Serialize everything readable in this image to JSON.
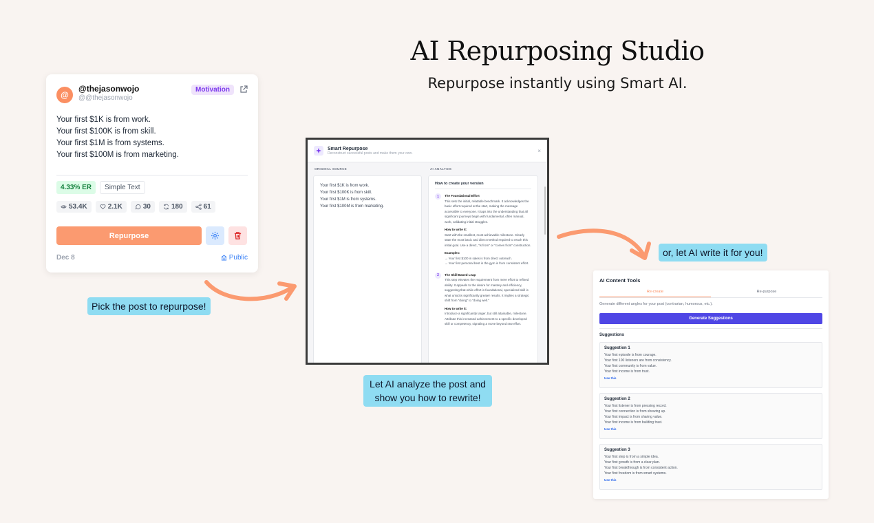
{
  "hero": {
    "title": "AI Repurposing Studio",
    "subtitle": "Repurpose instantly using Smart AI."
  },
  "callouts": {
    "pick": "Pick the post to repurpose!",
    "analyze_1": "Let AI analyze the post and",
    "analyze_2": "show you how to rewrite!",
    "write": "or, let AI write it for you!"
  },
  "post_card": {
    "avatar": "@",
    "name": "@thejasonwojo",
    "handle": "@@thejasonwojo",
    "tag": "Motivation",
    "lines": [
      "Your first $1K is from work.",
      "Your first $100K is from skill.",
      "Your first $1M is from systems.",
      "Your first $100M is from marketing."
    ],
    "er": "4.33% ER",
    "type": "Simple Text",
    "stats": {
      "views": "53.4K",
      "likes": "2.1K",
      "comments": "30",
      "reposts": "180",
      "shares": "61"
    },
    "repurpose_label": "Repurpose",
    "date": "Dec 8",
    "visibility": "Public"
  },
  "modal": {
    "title": "Smart Repurpose",
    "subtitle": "Deconstruct successful posts and make them your own.",
    "close": "×",
    "source_label": "ORIGINAL SOURCE",
    "analysis_label": "AI ANALYSIS",
    "source_lines": [
      "Your first $1K is from work.",
      "Your first $100K is from skill.",
      "Your first $1M is from systems.",
      "Your first $100M is from marketing."
    ],
    "analysis_title": "How to create your version",
    "step1": {
      "num": "1",
      "title": "The Foundational Effort",
      "desc": "This sets the initial, relatable benchmark. It acknowledges the basic effort required at the start, making the message accessible to everyone. It taps into the understanding that all significant journeys begin with fundamental, often manual, work, validating initial struggles.",
      "how_title": "How to write it:",
      "how": "Start with the smallest, most achievable milestone. Clearly state the most basic and direct method required to reach this initial goal. Use a direct, \"is from\" or \"comes from\" construction.",
      "ex_title": "Examples:",
      "ex1": "→ Your first $100 in sales is from direct outreach.",
      "ex2": "→ Your first personal best in the gym is from consistent effort."
    },
    "step2": {
      "num": "2",
      "title": "The Skill-Based Leap",
      "desc": "This step elevates the requirement from mere effort to refined ability. It appeals to the desire for mastery and efficiency, suggesting that while effort is foundational, specialized skill is what unlocks significantly greater results. It implies a strategic shift from \"doing\" to \"doing well.\"",
      "how_title": "How to write it:",
      "how": "Introduce a significantly larger, but still attainable, milestone. Attribute this increased achievement to a specific developed skill or competency, signaling a move beyond raw effort."
    }
  },
  "tools": {
    "title": "AI Content Tools",
    "tab_recreate": "Re-create",
    "tab_repurpose": "Re-purpose",
    "desc": "Generate different angles for your post (contrarian, humorous, etc.).",
    "generate": "Generate Suggestions",
    "suggestions_heading": "Suggestions",
    "use": "Use this",
    "suggestions": [
      {
        "title": "Suggestion 1",
        "lines": [
          "Your first episode is from courage.",
          "Your first 100 listeners are from consistency.",
          "Your first community is from value.",
          "Your first income is from trust."
        ]
      },
      {
        "title": "Suggestion 2",
        "lines": [
          "Your first listener is from pressing record.",
          "Your first connection is from showing up.",
          "Your first impact is from sharing value.",
          "Your first income is from building trust."
        ]
      },
      {
        "title": "Suggestion 3",
        "lines": [
          "Your first step is from a simple idea.",
          "Your first growth is from a clear plan.",
          "Your first breakthrough is from consistent action.",
          "Your first freedom is from smart systems."
        ]
      }
    ]
  },
  "colors": {
    "accent": "#fb8f62",
    "primary": "#4f46e5",
    "callout": "#8fdcf2",
    "background": "#f9f4f1"
  }
}
